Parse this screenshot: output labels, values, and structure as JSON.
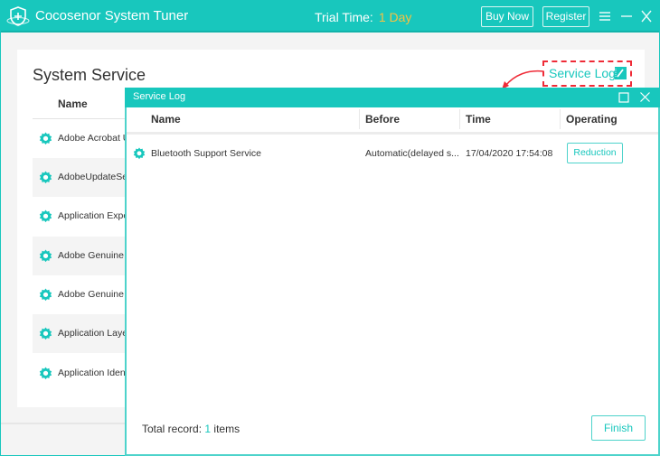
{
  "app": {
    "title": "Cocosenor System Tuner",
    "trial_label": "Trial Time:",
    "trial_value": "1 Day",
    "buy_now": "Buy Now",
    "register": "Register"
  },
  "main": {
    "title": "System Service",
    "service_log_link": "Service Log",
    "column_name": "Name",
    "services": [
      {
        "name": "Adobe Acrobat Update Service"
      },
      {
        "name": "AdobeUpdateService"
      },
      {
        "name": "Application Experience"
      },
      {
        "name": "Adobe Genuine Monitor Service"
      },
      {
        "name": "Adobe Genuine Software Integrity Service"
      },
      {
        "name": "Application Layer Gateway Service"
      },
      {
        "name": "Application Identity"
      }
    ]
  },
  "dialog": {
    "title": "Service Log",
    "columns": [
      "Name",
      "Before",
      "Time",
      "Operating"
    ],
    "rows": [
      {
        "name": "Bluetooth Support Service",
        "before": "Automatic(delayed s...",
        "time": "17/04/2020 17:54:08",
        "action": "Reduction"
      }
    ],
    "total_prefix": "Total record:",
    "total_count": "1",
    "total_suffix": "items",
    "finish": "Finish"
  },
  "colors": {
    "accent": "#18c7bd",
    "highlight_red": "#ef2b37",
    "trial_yellow": "#f5c242"
  }
}
